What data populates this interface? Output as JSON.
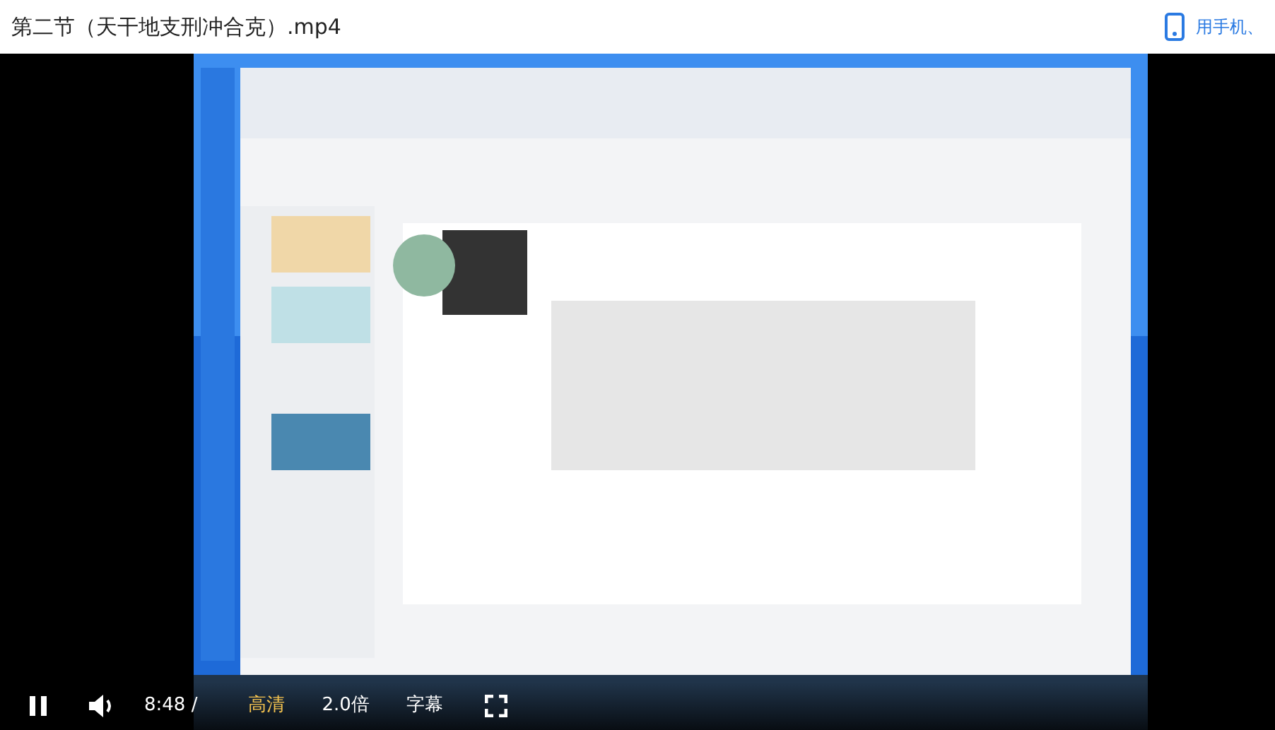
{
  "header": {
    "title": "第二节（天干地支刑冲合克）.mp4",
    "phone_link": "用手机、"
  },
  "controls": {
    "playing": true,
    "time": "8:48 /",
    "quality": "高清",
    "speed": "2.0倍",
    "subtitles": "字幕"
  }
}
